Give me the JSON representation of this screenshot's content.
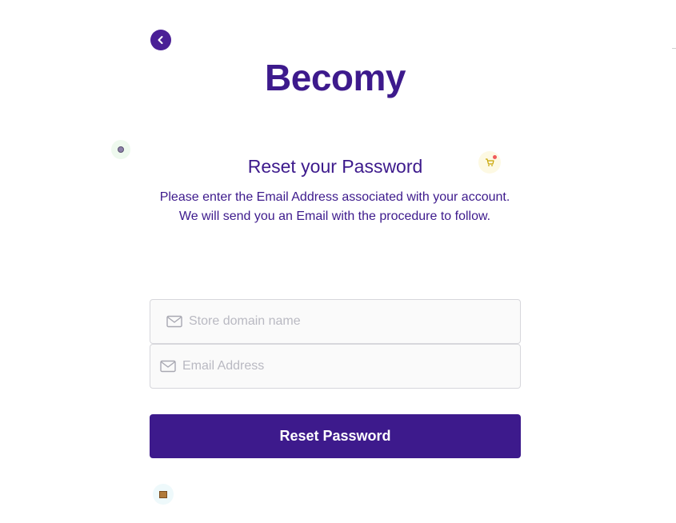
{
  "app": {
    "brand_name": "Becomy"
  },
  "nav": {
    "back_icon": "chevron-left-icon"
  },
  "form": {
    "heading": "Reset your Password",
    "description": "Please enter the Email Address associated with your account. We will send you an Email with the procedure to follow.",
    "store_domain": {
      "placeholder": "Store domain name",
      "value": "",
      "icon": "mail-icon"
    },
    "email": {
      "placeholder": "Email Address",
      "value": "",
      "icon": "mail-icon"
    },
    "submit_label": "Reset Password"
  },
  "decorations": {
    "left_icon": "gear-icon",
    "cart_icon": "cart-icon",
    "box_icon": "package-icon"
  },
  "colors": {
    "brand": "#3d1a8c",
    "back_button": "#4a1f96",
    "field_border": "#d7d7dc",
    "placeholder": "#b9b9c2"
  }
}
